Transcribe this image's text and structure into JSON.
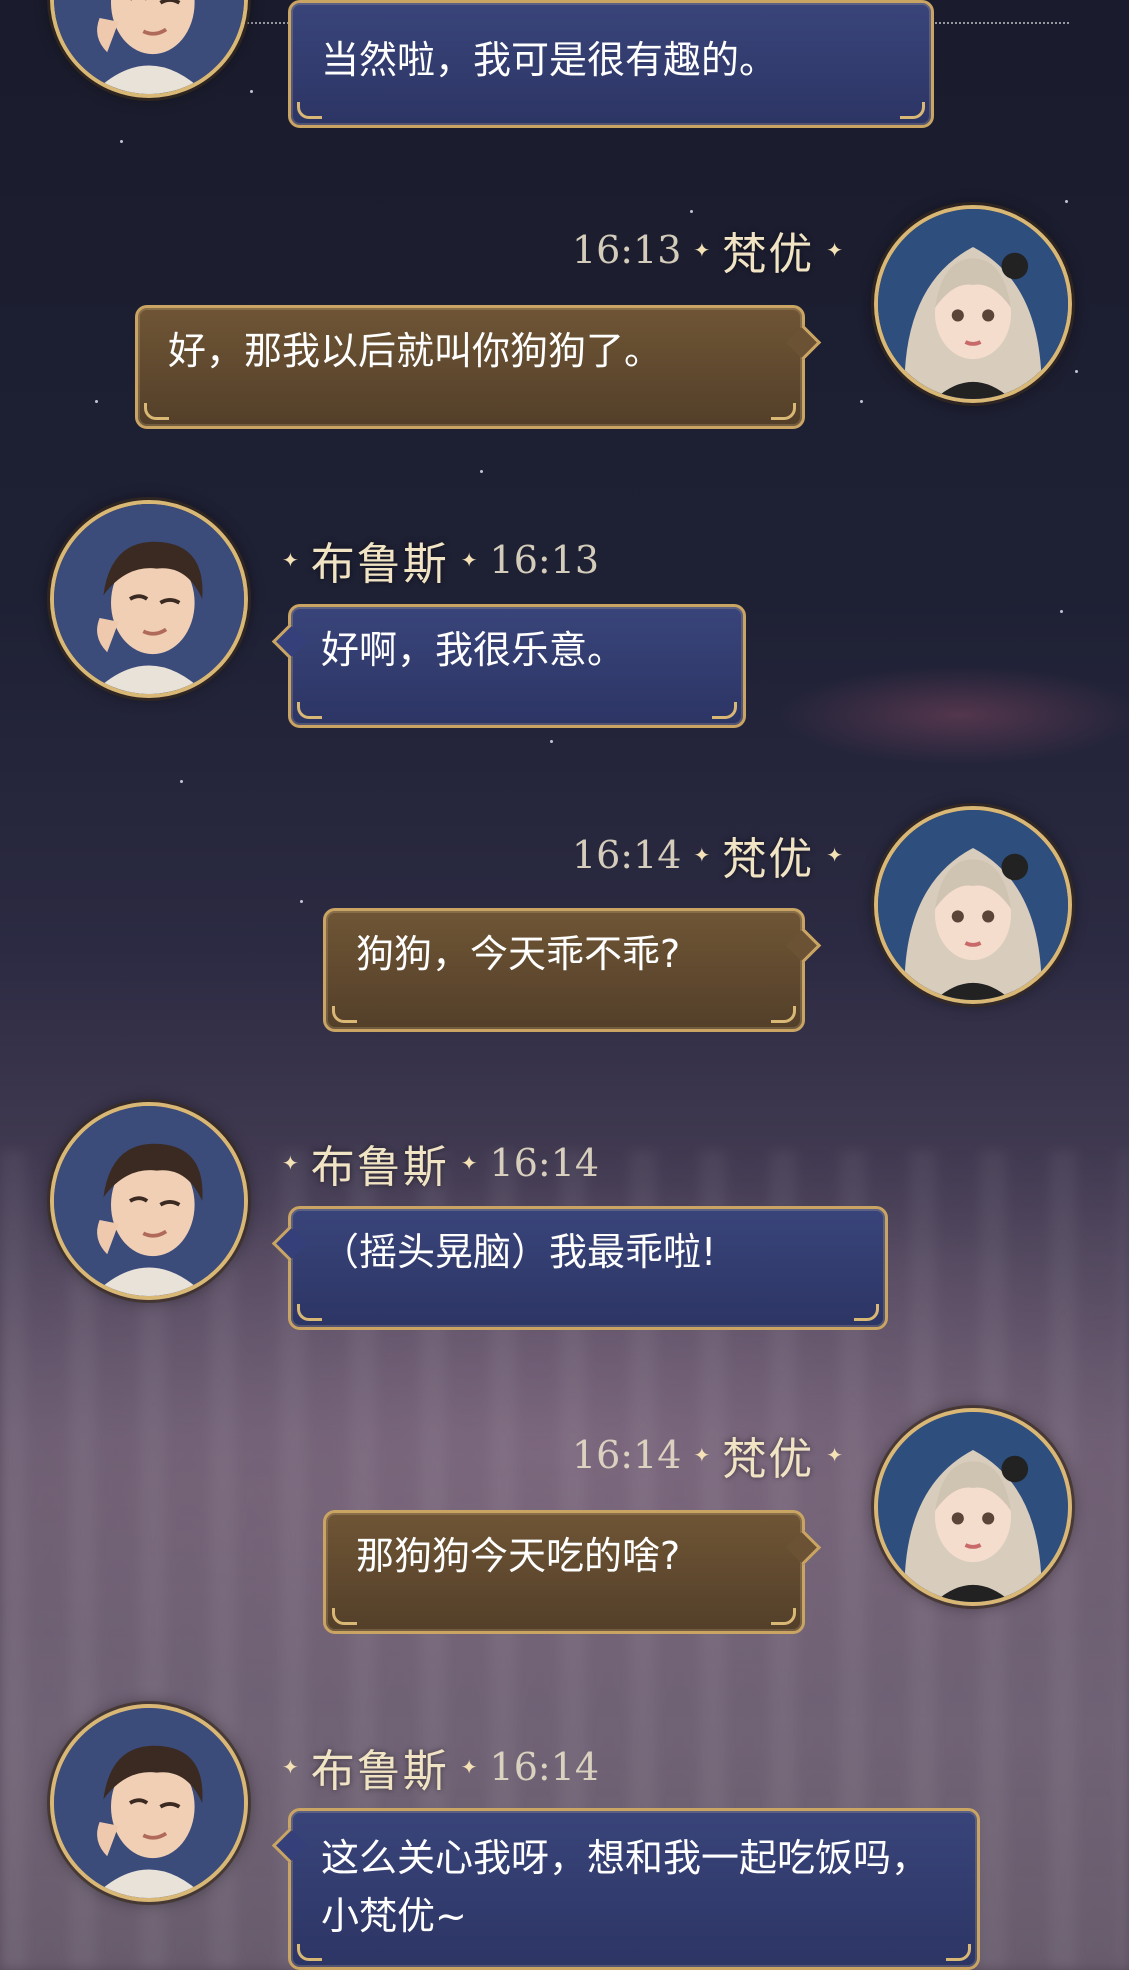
{
  "colors": {
    "bubble_blue": "#2f3a6c",
    "bubble_brown": "#5f4830",
    "gold_border": "#c9a463",
    "name_text": "#f1e4c4"
  },
  "characters": {
    "bruce": {
      "name": "布鲁斯",
      "avatar_icon": "bruce-avatar-icon"
    },
    "fanyou": {
      "name": "梵优",
      "avatar_icon": "fanyou-avatar-icon"
    }
  },
  "messages": [
    {
      "sender": "bruce",
      "time": "",
      "text": "当然啦，我可是很有趣的。"
    },
    {
      "sender": "fanyou",
      "time": "16:13",
      "text": "好，那我以后就叫你狗狗了。"
    },
    {
      "sender": "bruce",
      "time": "16:13",
      "text": "好啊，我很乐意。"
    },
    {
      "sender": "fanyou",
      "time": "16:14",
      "text": "狗狗，今天乖不乖?"
    },
    {
      "sender": "bruce",
      "time": "16:14",
      "text": "（摇头晃脑）我最乖啦!"
    },
    {
      "sender": "fanyou",
      "time": "16:14",
      "text": "那狗狗今天吃的啥?"
    },
    {
      "sender": "bruce",
      "time": "16:14",
      "text": "这么关心我呀，想和我一起吃饭吗，小梵优~"
    }
  ]
}
